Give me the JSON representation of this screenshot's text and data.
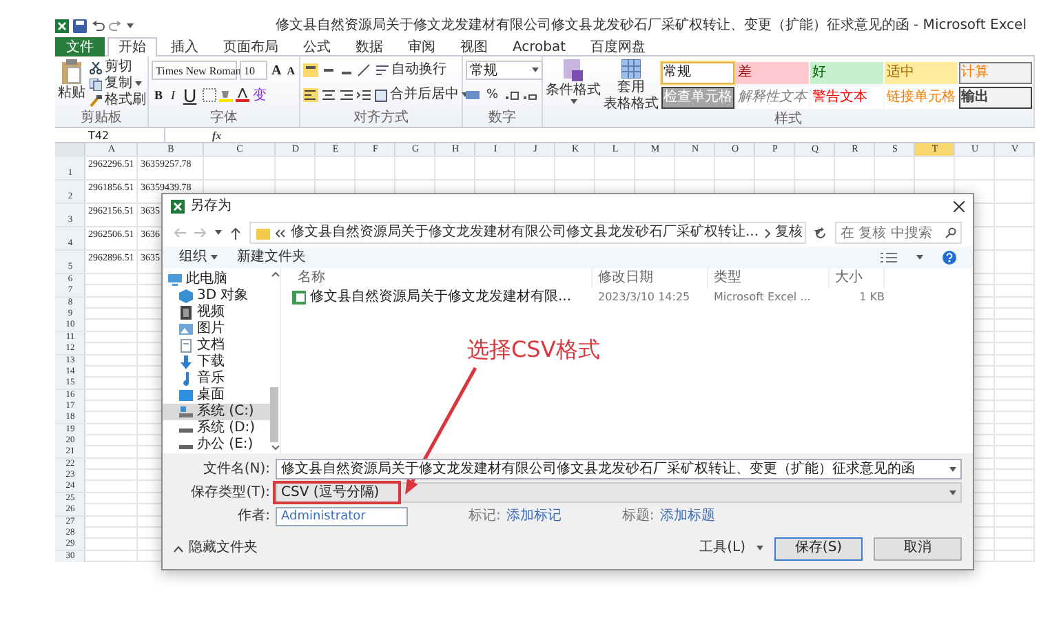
{
  "window": {
    "title": "修文县自然资源局关于修文龙发建材有限公司修文县龙发砂石厂采矿权转让、变更（扩能）征求意见的函 - Microsoft Excel"
  },
  "ribbon_tabs": [
    {
      "label": "文件",
      "kind": "file",
      "selected": false
    },
    {
      "label": "开始",
      "kind": "tab",
      "selected": true
    },
    {
      "label": "插入",
      "kind": "tab",
      "selected": false
    },
    {
      "label": "页面布局",
      "kind": "tab",
      "selected": false
    },
    {
      "label": "公式",
      "kind": "tab",
      "selected": false
    },
    {
      "label": "数据",
      "kind": "tab",
      "selected": false
    },
    {
      "label": "审阅",
      "kind": "tab",
      "selected": false
    },
    {
      "label": "视图",
      "kind": "tab",
      "selected": false
    },
    {
      "label": "Acrobat",
      "kind": "tab",
      "selected": false
    },
    {
      "label": "百度网盘",
      "kind": "tab",
      "selected": false
    }
  ],
  "ribbon": {
    "clipboard": {
      "paste": "粘贴",
      "cut": "剪切",
      "copy": "复制",
      "format_painter": "格式刷",
      "label": "剪贴板"
    },
    "font": {
      "name": "Times New Roman",
      "size": "10",
      "grow": "A",
      "shrink": "A",
      "bold": "B",
      "italic": "I",
      "underline": "U",
      "phonetic": "变",
      "label": "字体"
    },
    "alignment": {
      "wrap_text": "自动换行",
      "merge_center": "合并后居中",
      "label": "对齐方式"
    },
    "number": {
      "format": "常规",
      "percent": "%",
      "label": "数字"
    },
    "styles": {
      "conditional": "条件格式",
      "format_table": [
        "套用",
        "表格格式"
      ],
      "label": "样式",
      "cell_styles": [
        {
          "label": "常规",
          "kind": "normal",
          "selected": true
        },
        {
          "label": "差",
          "kind": "bad",
          "selected": false
        },
        {
          "label": "好",
          "kind": "good",
          "selected": false
        },
        {
          "label": "适中",
          "kind": "neutral",
          "selected": false
        },
        {
          "label": "计算",
          "kind": "calculation",
          "selected": false
        },
        {
          "label": "检查单元格",
          "kind": "check",
          "selected": false
        },
        {
          "label": "解释性文本",
          "kind": "explanatory",
          "selected": false
        },
        {
          "label": "警告文本",
          "kind": "warning",
          "selected": false
        },
        {
          "label": "链接单元格",
          "kind": "linked",
          "selected": false
        },
        {
          "label": "输出",
          "kind": "output",
          "selected": false
        }
      ]
    }
  },
  "formula_bar": {
    "name_box": "T42",
    "function_label": "fx"
  },
  "sheet": {
    "columns": [
      {
        "label": "A",
        "selected": false
      },
      {
        "label": "B",
        "selected": false
      },
      {
        "label": "C",
        "selected": false
      },
      {
        "label": "D",
        "selected": false
      },
      {
        "label": "E",
        "selected": false
      },
      {
        "label": "F",
        "selected": false
      },
      {
        "label": "G",
        "selected": false
      },
      {
        "label": "H",
        "selected": false
      },
      {
        "label": "I",
        "selected": false
      },
      {
        "label": "J",
        "selected": false
      },
      {
        "label": "K",
        "selected": false
      },
      {
        "label": "L",
        "selected": false
      },
      {
        "label": "M",
        "selected": false
      },
      {
        "label": "N",
        "selected": false
      },
      {
        "label": "O",
        "selected": false
      },
      {
        "label": "P",
        "selected": false
      },
      {
        "label": "Q",
        "selected": false
      },
      {
        "label": "R",
        "selected": false
      },
      {
        "label": "S",
        "selected": false
      },
      {
        "label": "T",
        "selected": true
      },
      {
        "label": "U",
        "selected": false
      },
      {
        "label": "V",
        "selected": false
      }
    ],
    "rows": [
      {
        "label": "1",
        "cells": [
          "2962296.51",
          "36359257.78"
        ]
      },
      {
        "label": "2",
        "cells": [
          "2961856.51",
          "36359439.78"
        ]
      },
      {
        "label": "3",
        "cells": [
          "2962156.51",
          "3635"
        ]
      },
      {
        "label": "4",
        "cells": [
          "2962506.51",
          "3636"
        ]
      },
      {
        "label": "5",
        "cells": [
          "2962896.51",
          "3635"
        ]
      },
      {
        "label": "6"
      },
      {
        "label": "7"
      },
      {
        "label": "8"
      },
      {
        "label": "9"
      },
      {
        "label": "10"
      },
      {
        "label": "11"
      },
      {
        "label": "12"
      },
      {
        "label": "13"
      },
      {
        "label": "14"
      },
      {
        "label": "15"
      },
      {
        "label": "16"
      },
      {
        "label": "17"
      },
      {
        "label": "18"
      },
      {
        "label": "19"
      },
      {
        "label": "20"
      },
      {
        "label": "21"
      },
      {
        "label": "22"
      },
      {
        "label": "23"
      },
      {
        "label": "24"
      },
      {
        "label": "25"
      },
      {
        "label": "26"
      },
      {
        "label": "27"
      },
      {
        "label": "28"
      },
      {
        "label": "29"
      },
      {
        "label": "30"
      }
    ]
  },
  "save_dialog": {
    "title": "另存为",
    "path": [
      "修文县自然资源局关于修文龙发建材有限公司修文县龙发砂石厂采矿权转让...",
      "复核"
    ],
    "search_placeholder": "在 复核 中搜索",
    "organize": "组织",
    "new_folder": "新建文件夹",
    "sidebar": [
      {
        "label": "此电脑",
        "kind": "pc",
        "selected": false,
        "children": [
          {
            "label": "3D 对象",
            "kind": "cube",
            "selected": false
          },
          {
            "label": "视频",
            "kind": "video",
            "selected": false
          },
          {
            "label": "图片",
            "kind": "picture",
            "selected": false
          },
          {
            "label": "文档",
            "kind": "document",
            "selected": false
          },
          {
            "label": "下载",
            "kind": "download",
            "selected": false
          },
          {
            "label": "音乐",
            "kind": "music",
            "selected": false
          },
          {
            "label": "桌面",
            "kind": "desktop",
            "selected": false
          },
          {
            "label": "系统 (C:)",
            "kind": "system_drive",
            "selected": true
          },
          {
            "label": "系统 (D:)",
            "kind": "drive",
            "selected": false
          },
          {
            "label": "办公 (E:)",
            "kind": "drive",
            "selected": false
          }
        ]
      }
    ],
    "columns": [
      "名称",
      "修改日期",
      "类型",
      "大小"
    ],
    "files": [
      {
        "name": "修文县自然资源局关于修文龙发建材有限...",
        "modified": "2023/3/10 14:25",
        "type": "Microsoft Excel ...",
        "size": "1 KB"
      }
    ],
    "file_name": {
      "label": "文件名(N):",
      "value": "修文县自然资源局关于修文龙发建材有限公司修文县龙发砂石厂采矿权转让、变更（扩能）征求意见的函"
    },
    "save_type": {
      "label": "保存类型(T):",
      "value": "CSV (逗号分隔)"
    },
    "author": {
      "label": "作者:",
      "value": "Administrator"
    },
    "tags": {
      "label": "标记:",
      "link": "添加标记"
    },
    "title_field": {
      "label": "标题:",
      "link": "添加标题"
    },
    "hide_folders": "隐藏文件夹",
    "tools": "工具(L)",
    "save": "保存(S)",
    "cancel": "取消"
  },
  "annotation": {
    "text": "选择CSV格式"
  }
}
